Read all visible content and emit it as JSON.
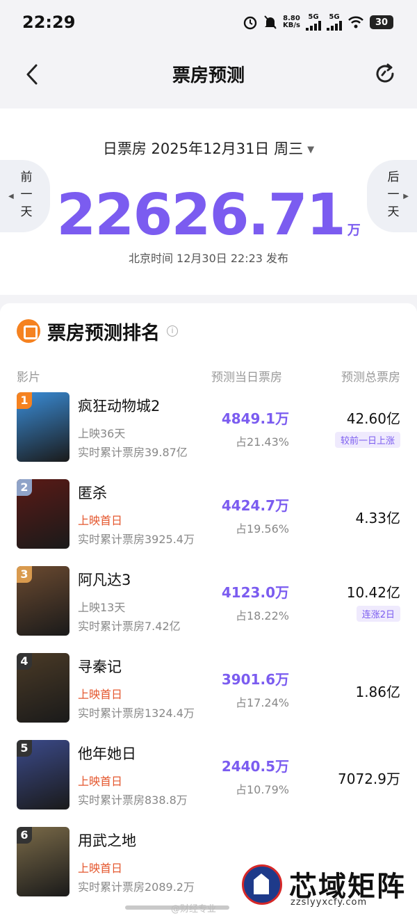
{
  "status_bar": {
    "time": "22:29",
    "net_speed_value": "8.80",
    "net_speed_unit": "KB/s",
    "signal_1": "5G",
    "signal_2": "5G",
    "battery": "30"
  },
  "nav": {
    "title": "票房预测",
    "back_icon": "chevron-left-icon",
    "refresh_icon": "refresh-icon"
  },
  "summary": {
    "date_label": "日票房 2025年12月31日 周三",
    "prev_day_label": "前一天",
    "next_day_label": "后一天",
    "total_value": "22626.71",
    "total_unit": "万",
    "publish_text": "北京时间 12月30日 22:23 发布"
  },
  "ranking": {
    "title": "票房预测排名",
    "columns": {
      "film": "影片",
      "day_box": "预测当日票房",
      "total_box": "预测总票房"
    },
    "movies": [
      {
        "rank": "1",
        "name": "疯狂动物城2",
        "days": "上映36天",
        "cumulative": "实时累计票房39.87亿",
        "day_box": "4849.1万",
        "share": "占21.43%",
        "total_box": "42.60亿",
        "trend": "较前一日上涨",
        "poster_color": "#3a8dd8",
        "badge_color": "#f58220"
      },
      {
        "rank": "2",
        "name": "匿杀",
        "days": "上映首日",
        "cumulative": "实时累计票房3925.4万",
        "day_box": "4424.7万",
        "share": "占19.56%",
        "total_box": "4.33亿",
        "trend": "",
        "poster_color": "#5a1a16",
        "badge_color": "#8fa3c8"
      },
      {
        "rank": "3",
        "name": "阿凡达3",
        "days": "上映13天",
        "cumulative": "实时累计票房7.42亿",
        "day_box": "4123.0万",
        "share": "占18.22%",
        "total_box": "10.42亿",
        "trend": "连涨2日",
        "poster_color": "#6b4a30",
        "badge_color": "#d99a4e"
      },
      {
        "rank": "4",
        "name": "寻秦记",
        "days": "上映首日",
        "cumulative": "实时累计票房1324.4万",
        "day_box": "3901.6万",
        "share": "占17.24%",
        "total_box": "1.86亿",
        "trend": "",
        "poster_color": "#4a3a26",
        "badge_color": "#333333"
      },
      {
        "rank": "5",
        "name": "他年她日",
        "days": "上映首日",
        "cumulative": "实时累计票房838.8万",
        "day_box": "2440.5万",
        "share": "占10.79%",
        "total_box": "7072.9万",
        "trend": "",
        "poster_color": "#3b4a8a",
        "badge_color": "#333333"
      },
      {
        "rank": "6",
        "name": "用武之地",
        "days": "上映首日",
        "cumulative": "实时累计票房2089.2万",
        "day_box": "",
        "share": "",
        "total_box": "",
        "trend": "",
        "poster_color": "#7a6a48",
        "badge_color": "#333333"
      }
    ]
  },
  "watermark": {
    "weibo": "@财经专业",
    "site_name": "芯域矩阵",
    "site_url": "zzslyyxcfy.com"
  }
}
